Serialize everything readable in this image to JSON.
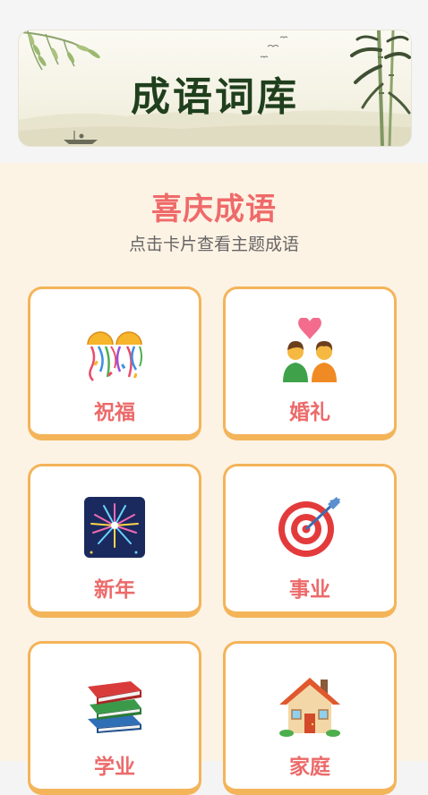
{
  "banner": {
    "title": "成语词库"
  },
  "section": {
    "title": "喜庆成语",
    "subtitle": "点击卡片查看主题成语"
  },
  "cards": [
    {
      "label": "祝福",
      "icon": "confetti-ball-icon"
    },
    {
      "label": "婚礼",
      "icon": "couple-with-heart-icon"
    },
    {
      "label": "新年",
      "icon": "fireworks-icon"
    },
    {
      "label": "事业",
      "icon": "direct-hit-target-icon"
    },
    {
      "label": "学业",
      "icon": "books-icon"
    },
    {
      "label": "家庭",
      "icon": "house-with-garden-icon"
    }
  ],
  "colors": {
    "accent": "#ef6a6a",
    "card_border": "#f4b45a",
    "background": "#fdf3e4",
    "banner_title": "#1f3f1d"
  }
}
